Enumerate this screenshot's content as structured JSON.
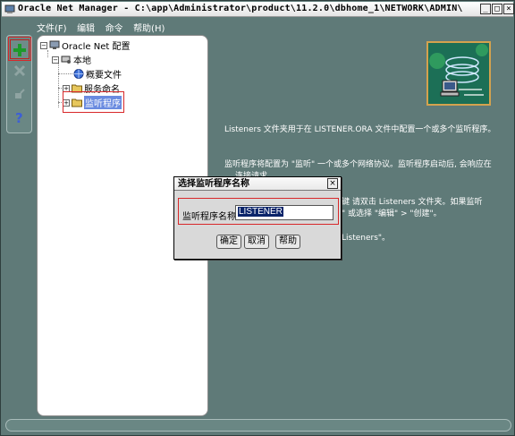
{
  "window": {
    "title": "Oracle Net Manager - C:\\app\\Administrator\\product\\11.2.0\\dbhome_1\\NETWORK\\ADMIN\\",
    "minimize": "_",
    "maximize": "□",
    "close": "×"
  },
  "menu": {
    "items": [
      "文件(F)",
      "编辑",
      "命令",
      "帮助(H)"
    ]
  },
  "tree": {
    "root": "Oracle Net 配置",
    "local": "本地",
    "children": [
      "概要文件",
      "服务命名",
      "监听程序"
    ]
  },
  "description": {
    "p1": "Listeners 文件夹用于在 LISTENER.ORA 文件中配置一个或多个监听程序。",
    "p2": "监听程序将配置为 \"监听\" 一个或多个网络协议。监听程序启动后, 会响应在",
    "p2b": "连接请求。",
    "p3a": "键 请双击 Listeners 文件夹。如果监听",
    "p3b": "\" 或选择 \"编辑\" > \"创建\"。",
    "p4": "Listeners\"。"
  },
  "dialog": {
    "title": "选择监听程序名称",
    "close": "×",
    "label": "监听程序名称:",
    "value": "LISTENER",
    "ok": "确定",
    "cancel": "取消",
    "help": "帮助"
  },
  "colors": {
    "background": "#5f7a78",
    "highlight": "#d8282a",
    "selection": "#0a246a"
  }
}
